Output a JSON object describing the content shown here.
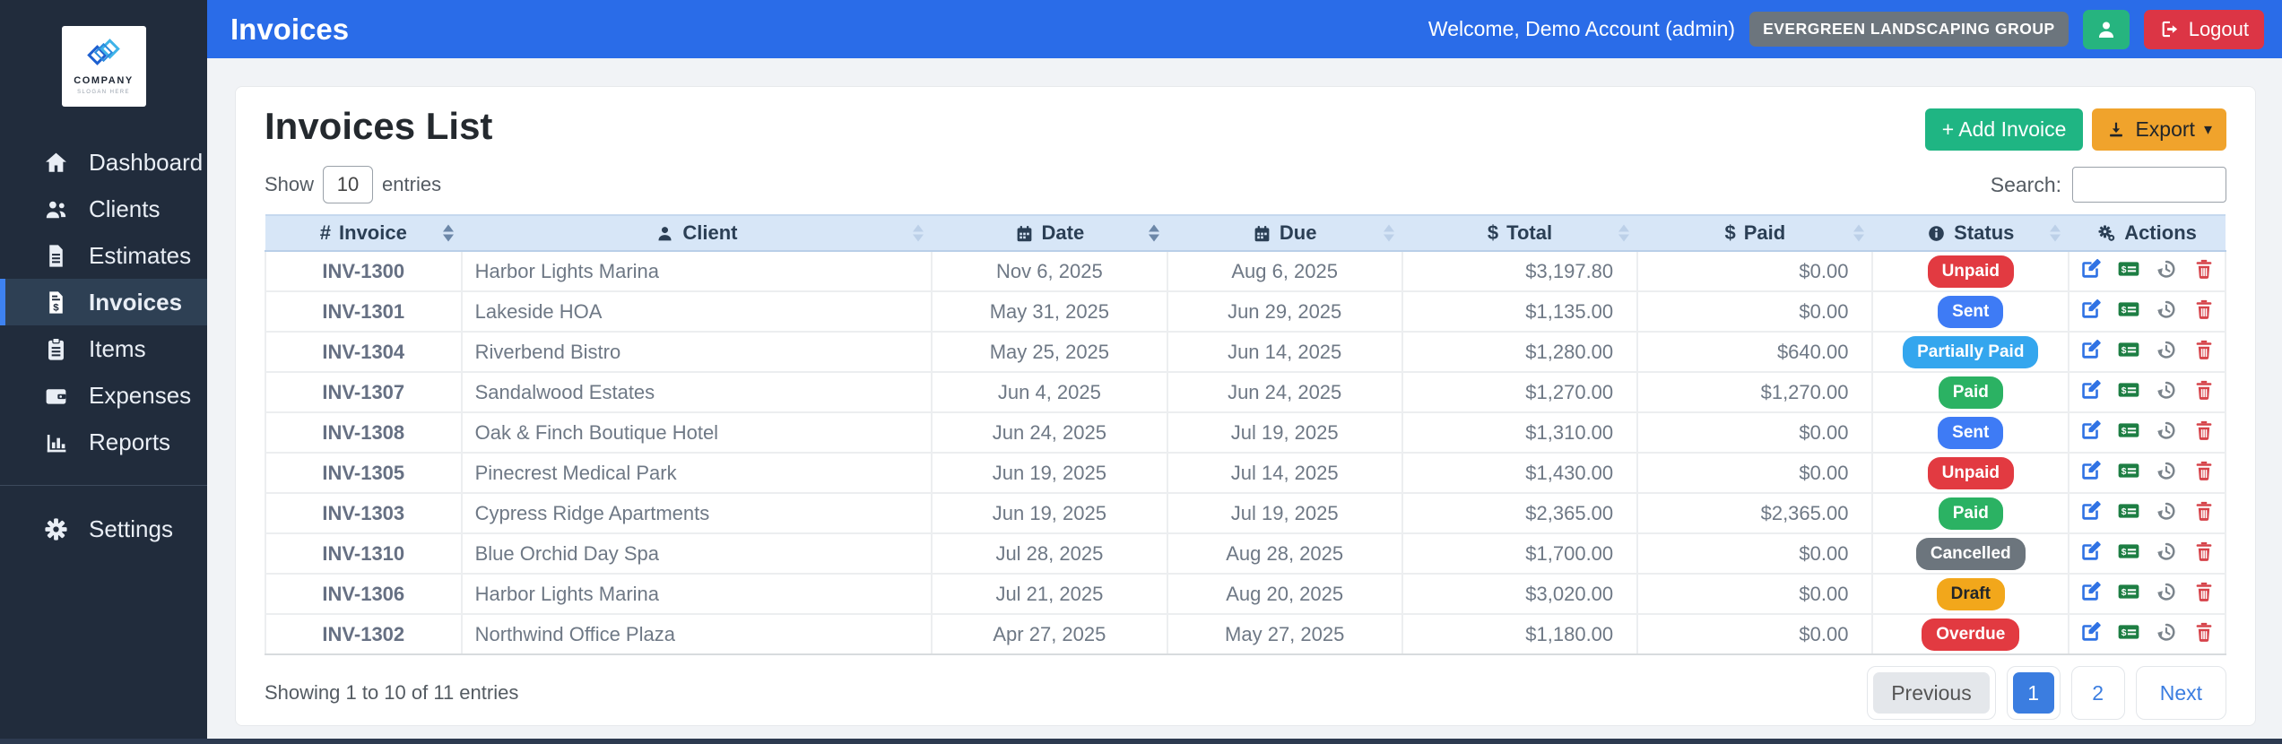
{
  "header": {
    "title": "Invoices",
    "welcome": "Welcome, Demo Account (admin)",
    "org_badge": "EVERGREEN LANDSCAPING GROUP",
    "logout_label": "Logout",
    "icons": [
      "user-icon",
      "sign-out-icon"
    ]
  },
  "sidebar": {
    "logo": {
      "name": "COMPANY",
      "slogan": "SLOGAN HERE",
      "mark": "company-logo-mark"
    },
    "items": [
      {
        "label": "Dashboard",
        "icon": "home-icon",
        "active": false
      },
      {
        "label": "Clients",
        "icon": "users-icon",
        "active": false
      },
      {
        "label": "Estimates",
        "icon": "document-icon",
        "active": false
      },
      {
        "label": "Invoices",
        "icon": "invoice-icon",
        "active": true
      },
      {
        "label": "Items",
        "icon": "clipboard-icon",
        "active": false
      },
      {
        "label": "Expenses",
        "icon": "wallet-icon",
        "active": false
      },
      {
        "label": "Reports",
        "icon": "bar-chart-icon",
        "active": false
      },
      {
        "label": "Settings",
        "icon": "gear-icon",
        "active": false
      }
    ]
  },
  "main": {
    "card_title": "Invoices List",
    "add_invoice_label": "+ Add Invoice",
    "export_label": "Export",
    "show_label": "Show",
    "page_length": "10",
    "entries_label": "entries",
    "search_label": "Search:",
    "search_value": "",
    "table": {
      "columns": [
        {
          "label": "Invoice",
          "icon": "hash-icon"
        },
        {
          "label": "Client",
          "icon": "user-icon"
        },
        {
          "label": "Date",
          "icon": "calendar-icon"
        },
        {
          "label": "Due",
          "icon": "calendar-icon"
        },
        {
          "label": "Total",
          "icon": "dollar-icon"
        },
        {
          "label": "Paid",
          "icon": "dollar-icon"
        },
        {
          "label": "Status",
          "icon": "info-circle-icon"
        },
        {
          "label": "Actions",
          "icon": "gears-icon"
        }
      ],
      "rows": [
        {
          "invoice": "INV-1300",
          "client": "Harbor Lights Marina",
          "date": "Nov 6, 2025",
          "due": "Aug 6, 2025",
          "total": "$3,197.80",
          "paid": "$0.00",
          "status": "Unpaid"
        },
        {
          "invoice": "INV-1301",
          "client": "Lakeside HOA",
          "date": "May 31, 2025",
          "due": "Jun 29, 2025",
          "total": "$1,135.00",
          "paid": "$0.00",
          "status": "Sent"
        },
        {
          "invoice": "INV-1304",
          "client": "Riverbend Bistro",
          "date": "May 25, 2025",
          "due": "Jun 14, 2025",
          "total": "$1,280.00",
          "paid": "$640.00",
          "status": "Partially Paid"
        },
        {
          "invoice": "INV-1307",
          "client": "Sandalwood Estates",
          "date": "Jun 4, 2025",
          "due": "Jun 24, 2025",
          "total": "$1,270.00",
          "paid": "$1,270.00",
          "status": "Paid"
        },
        {
          "invoice": "INV-1308",
          "client": "Oak & Finch Boutique Hotel",
          "date": "Jun 24, 2025",
          "due": "Jul 19, 2025",
          "total": "$1,310.00",
          "paid": "$0.00",
          "status": "Sent"
        },
        {
          "invoice": "INV-1305",
          "client": "Pinecrest Medical Park",
          "date": "Jun 19, 2025",
          "due": "Jul 14, 2025",
          "total": "$1,430.00",
          "paid": "$0.00",
          "status": "Unpaid"
        },
        {
          "invoice": "INV-1303",
          "client": "Cypress Ridge Apartments",
          "date": "Jun 19, 2025",
          "due": "Jul 19, 2025",
          "total": "$2,365.00",
          "paid": "$2,365.00",
          "status": "Paid"
        },
        {
          "invoice": "INV-1310",
          "client": "Blue Orchid Day Spa",
          "date": "Jul 28, 2025",
          "due": "Aug 28, 2025",
          "total": "$1,700.00",
          "paid": "$0.00",
          "status": "Cancelled"
        },
        {
          "invoice": "INV-1306",
          "client": "Harbor Lights Marina",
          "date": "Jul 21, 2025",
          "due": "Aug 20, 2025",
          "total": "$3,020.00",
          "paid": "$0.00",
          "status": "Draft"
        },
        {
          "invoice": "INV-1302",
          "client": "Northwind Office Plaza",
          "date": "Apr 27, 2025",
          "due": "May 27, 2025",
          "total": "$1,180.00",
          "paid": "$0.00",
          "status": "Overdue"
        }
      ],
      "row_actions": [
        "edit-icon",
        "money-check-icon",
        "history-icon",
        "trash-icon"
      ]
    },
    "summary": "Showing 1 to 10 of 11 entries",
    "pagination": {
      "previous_label": "Previous",
      "pages": [
        "1",
        "2"
      ],
      "active_page": "1",
      "next_label": "Next"
    }
  },
  "status_colors": {
    "Unpaid": "#e23a41",
    "Sent": "#3e7bf5",
    "Partially Paid": "#34a6ee",
    "Paid": "#2bb263",
    "Cancelled": "#6c757d",
    "Draft": "#f2a71b",
    "Overdue": "#e23a41"
  },
  "status_dark_text": [
    "Draft"
  ],
  "colors": {
    "topbar": "#2a6ce8",
    "sidebar": "#212c3c",
    "sidebar_active_border": "#3e82f0",
    "table_header_bg": "#d7e6f7",
    "add_button": "#1fb583",
    "export_button": "#f0a32c",
    "logout_button": "#dc3545",
    "user_button": "#26b47f",
    "active_page": "#3b7de0",
    "edit_icon": "#2f72e4",
    "payment_icon": "#1d7e43",
    "history_icon": "#7b848c",
    "delete_icon": "#d6434a"
  }
}
